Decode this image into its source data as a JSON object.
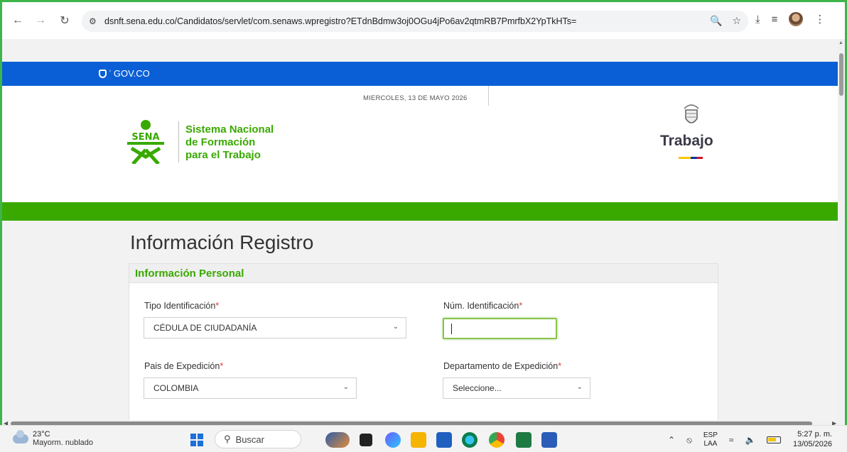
{
  "browser": {
    "url": "dsnft.sena.edu.co/Candidatos/servlet/com.senaws.wpregistro?ETdnBdmw3oj0OGu4jPo6av2qtmRB7PmrfbX2YpTkHTs="
  },
  "gov_bar": {
    "label": "GOV.CO"
  },
  "header": {
    "date": "MIERCOLES, 13 DE MAYO 2026",
    "sena_logo_text": "SENA",
    "sena_lines": [
      "Sistema Nacional",
      "de Formación",
      "para el Trabajo"
    ],
    "ministry": "Trabajo"
  },
  "form": {
    "title": "Información Registro",
    "section": "Información Personal",
    "required_mark": "*",
    "fields": {
      "tipo_id": {
        "label": "Tipo Identificación",
        "value": "CÉDULA DE CIUDADANÍA"
      },
      "num_id": {
        "label": "Núm. Identificación",
        "value": ""
      },
      "pais": {
        "label": "Pais de Expedición",
        "value": "COLOMBIA"
      },
      "depto": {
        "label": "Departamento de Expedición",
        "value": "Seleccione..."
      }
    }
  },
  "taskbar": {
    "weather_temp": "23°C",
    "weather_desc": "Mayorm. nublado",
    "search_label": "Buscar",
    "lang_1": "ESP",
    "lang_2": "LAA",
    "time": "5:27 p. m.",
    "date": "13/05/2026"
  },
  "colors": {
    "accent_green": "#39a900",
    "gov_blue": "#0b5fd6",
    "required_red": "#e53935"
  }
}
